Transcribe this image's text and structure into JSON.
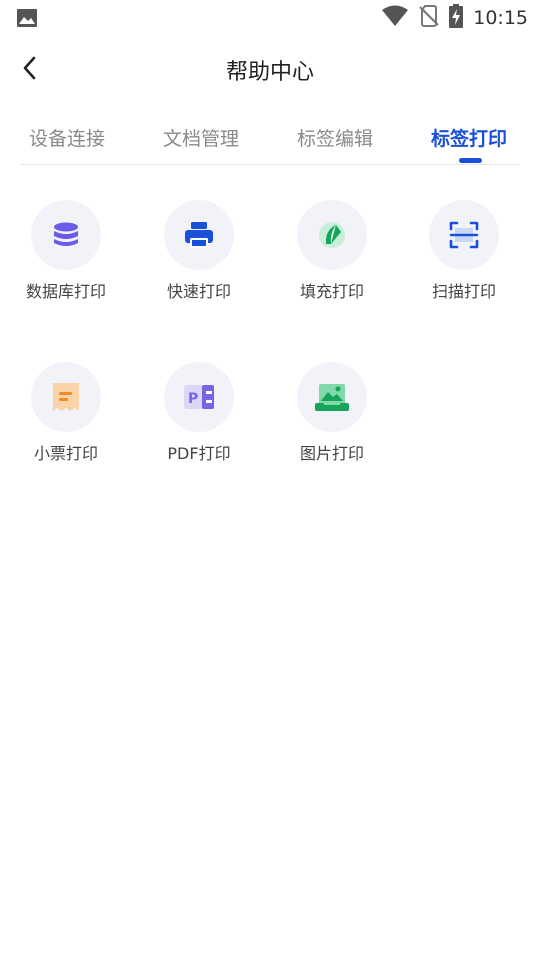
{
  "status_bar": {
    "time": "10:15",
    "icons": [
      "image-icon",
      "wifi-icon",
      "no-sim-icon",
      "battery-charging-icon"
    ]
  },
  "header": {
    "title": "帮助中心",
    "back_icon": "chevron-left-icon"
  },
  "tabs": [
    {
      "label": "设备连接",
      "active": false
    },
    {
      "label": "文档管理",
      "active": false
    },
    {
      "label": "标签编辑",
      "active": false
    },
    {
      "label": "标签打印",
      "active": true
    }
  ],
  "colors": {
    "accent": "#1a4fd8",
    "icon_bg": "#f1f3f8"
  },
  "items": [
    {
      "label": "数据库打印",
      "icon": "database-icon"
    },
    {
      "label": "快速打印",
      "icon": "printer-icon"
    },
    {
      "label": "填充打印",
      "icon": "fill-icon"
    },
    {
      "label": "扫描打印",
      "icon": "scan-icon"
    },
    {
      "label": "小票打印",
      "icon": "receipt-icon"
    },
    {
      "label": "PDF打印",
      "icon": "pdf-icon"
    },
    {
      "label": "图片打印",
      "icon": "image-print-icon"
    }
  ]
}
